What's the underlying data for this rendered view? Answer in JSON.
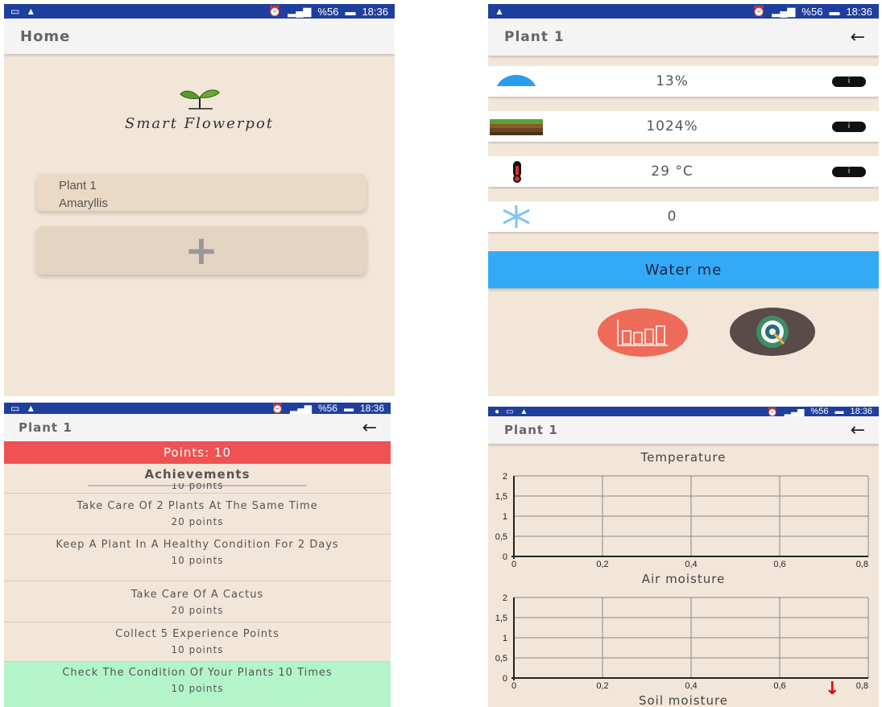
{
  "status_bar": {
    "a": {
      "left": [
        "▭",
        "▲"
      ],
      "battery_pct": "%56",
      "time": "18:36"
    },
    "b": {
      "left": [
        "▲"
      ],
      "battery_pct": "%56",
      "time": "18:36"
    },
    "c": {
      "left": [
        "▭",
        "▲"
      ],
      "battery_pct": "%56",
      "time": "18:36"
    },
    "d": {
      "left": [
        "●",
        "▭",
        "▲"
      ],
      "battery_pct": "%56",
      "time": "18:36"
    }
  },
  "home": {
    "title": "Home",
    "logo_text": "Smart Flowerpot",
    "plant_card": {
      "name": "Plant 1",
      "species": "Amaryllis"
    },
    "add_label": "+"
  },
  "detail": {
    "title": "Plant 1",
    "back": "←",
    "sensors": [
      {
        "icon": "water-drop-icon",
        "value": "13%",
        "info": "i"
      },
      {
        "icon": "soil-layers-icon",
        "value": "1024%",
        "info": "i"
      },
      {
        "icon": "thermometer-icon",
        "value": "29 °C",
        "info": "i"
      },
      {
        "icon": "snowflake-icon",
        "value": "0"
      }
    ],
    "water_button": "Water me",
    "colors": {
      "water": "#33aaf5",
      "stats": "#ee6b5a",
      "target": "#5a4a4a"
    }
  },
  "achievements": {
    "title": "Plant 1",
    "back": "←",
    "points": "Points: 10",
    "heading": "Achievements",
    "partial_top": "10 points",
    "items": [
      {
        "title": "Take Care Of 2 Plants At The Same Time",
        "points": "20 points",
        "done": false
      },
      {
        "title": "Keep A Plant In A Healthy Condition For 2 Days",
        "points": "10 points",
        "done": false
      },
      {
        "title": "Take Care Of A Cactus",
        "points": "20 points",
        "done": false
      },
      {
        "title": "Collect 5 Experience Points",
        "points": "10 points",
        "done": false
      },
      {
        "title": "Check The Condition Of Your Plants 10 Times",
        "points": "10 points",
        "done": true
      }
    ],
    "colors": {
      "points_bar": "#ee5253",
      "done": "#b3f5c9"
    }
  },
  "charts": {
    "title": "Plant 1",
    "back": "←",
    "scroll_hint": "↓",
    "chart_titles": [
      "Temperature",
      "Air moisture",
      "Soil moisture"
    ]
  },
  "chart_data": [
    {
      "type": "line",
      "title": "Temperature",
      "xlim": [
        0,
        0.8
      ],
      "ylim": [
        0,
        2
      ],
      "x_ticks": [
        "0",
        "0,2",
        "0,4",
        "0,6",
        "0,8"
      ],
      "y_ticks": [
        "0",
        "0,5",
        "1",
        "1,5",
        "2"
      ],
      "series": [],
      "grid": true
    },
    {
      "type": "line",
      "title": "Air moisture",
      "xlim": [
        0,
        0.8
      ],
      "ylim": [
        0,
        2
      ],
      "x_ticks": [
        "0",
        "0,2",
        "0,4",
        "0,6",
        "0,8"
      ],
      "y_ticks": [
        "0",
        "0,5",
        "1",
        "1,5",
        "2"
      ],
      "series": [],
      "grid": true
    }
  ]
}
